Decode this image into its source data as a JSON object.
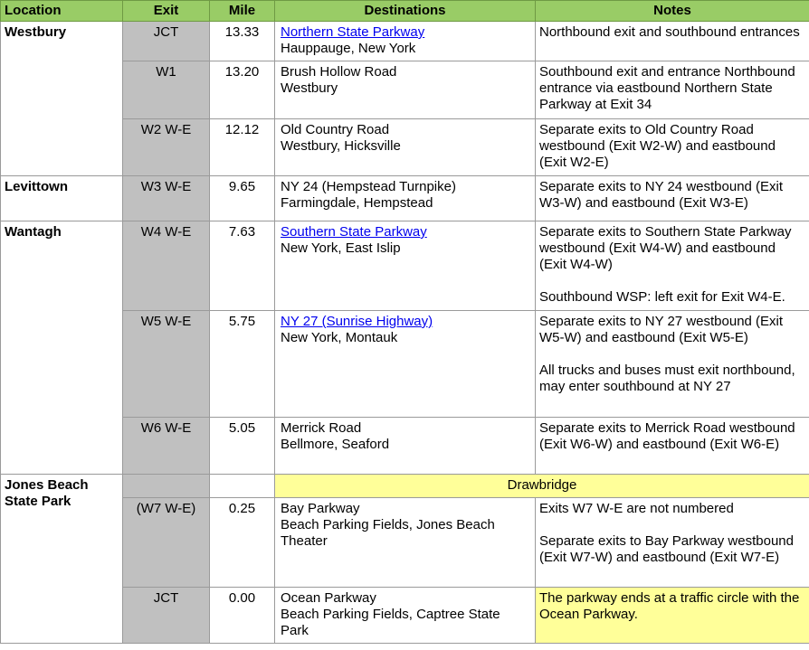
{
  "header": {
    "location": "Location",
    "exit": "Exit",
    "mile": "Mile",
    "destinations": "Destinations",
    "notes": "Notes"
  },
  "locations": {
    "westbury": "Westbury",
    "levittown": "Levittown",
    "wantagh": "Wantagh",
    "jones_beach": "Jones Beach State Park"
  },
  "rows": [
    {
      "exit": "JCT",
      "mile": "13.33",
      "dest_line1": "Northern State Parkway",
      "dest_line2": "Hauppauge, New York",
      "notes_p1": "Northbound exit and southbound entrances"
    },
    {
      "exit": "W1",
      "mile": "13.20",
      "dest_line1": "Brush Hollow Road",
      "dest_line2": "Westbury",
      "notes_p1": "Southbound exit and entrance Northbound entrance via eastbound Northern State Parkway at Exit 34"
    },
    {
      "exit": "W2 W-E",
      "mile": "12.12",
      "dest_line1": "Old Country Road",
      "dest_line2": "Westbury, Hicksville",
      "notes_p1": "Separate exits to Old Country Road westbound (Exit W2-W) and eastbound (Exit W2-E)"
    },
    {
      "exit": "W3 W-E",
      "mile": "9.65",
      "dest_line1": "NY 24 (Hempstead Turnpike)",
      "dest_line2": "Farmingdale, Hempstead",
      "notes_p1": "Separate exits to NY 24 westbound (Exit W3-W) and eastbound (Exit W3-E)"
    },
    {
      "exit": "W4 W-E",
      "mile": "7.63",
      "dest_line1": "Southern State Parkway",
      "dest_line2": "New York, East Islip",
      "notes_p1": "Separate exits to Southern State Parkway westbound (Exit W4-W) and eastbound (Exit W4-W)",
      "notes_p2": "Southbound WSP: left exit for Exit W4-E."
    },
    {
      "exit": "W5 W-E",
      "mile": "5.75",
      "dest_line1": "NY 27 (Sunrise Highway)",
      "dest_line2": "New York, Montauk",
      "notes_p1": "Separate exits to NY 27 westbound (Exit W5-W) and eastbound (Exit W5-E)",
      "notes_p2": "All trucks and buses must exit northbound, may enter southbound at NY 27"
    },
    {
      "exit": "W6 W-E",
      "mile": "5.05",
      "dest_line1": "Merrick Road",
      "dest_line2": "Bellmore, Seaford",
      "notes_p1": "Separate exits to Merrick Road westbound (Exit W6-W) and eastbound (Exit W6-E)"
    },
    {
      "drawbridge": "Drawbridge"
    },
    {
      "exit": "(W7 W-E)",
      "mile": "0.25",
      "dest_line1": "Bay Parkway",
      "dest_line2": "Beach Parking Fields, Jones Beach Theater",
      "notes_p1": "Exits W7 W-E are not numbered",
      "notes_p2": "Separate exits to Bay Parkway westbound (Exit W7-W) and eastbound (Exit W7-E)"
    },
    {
      "exit": "JCT",
      "mile": "0.00",
      "dest_line1": "Ocean Parkway",
      "dest_line2": "Beach Parking Fields, Captree State Park",
      "notes_p1": "The parkway ends at a traffic circle with the Ocean Parkway."
    }
  ],
  "colors": {
    "header_bg": "#99cc66",
    "exit_col_bg": "#c0c0c0",
    "highlight": "#ffff99",
    "link": "#0000ee"
  }
}
